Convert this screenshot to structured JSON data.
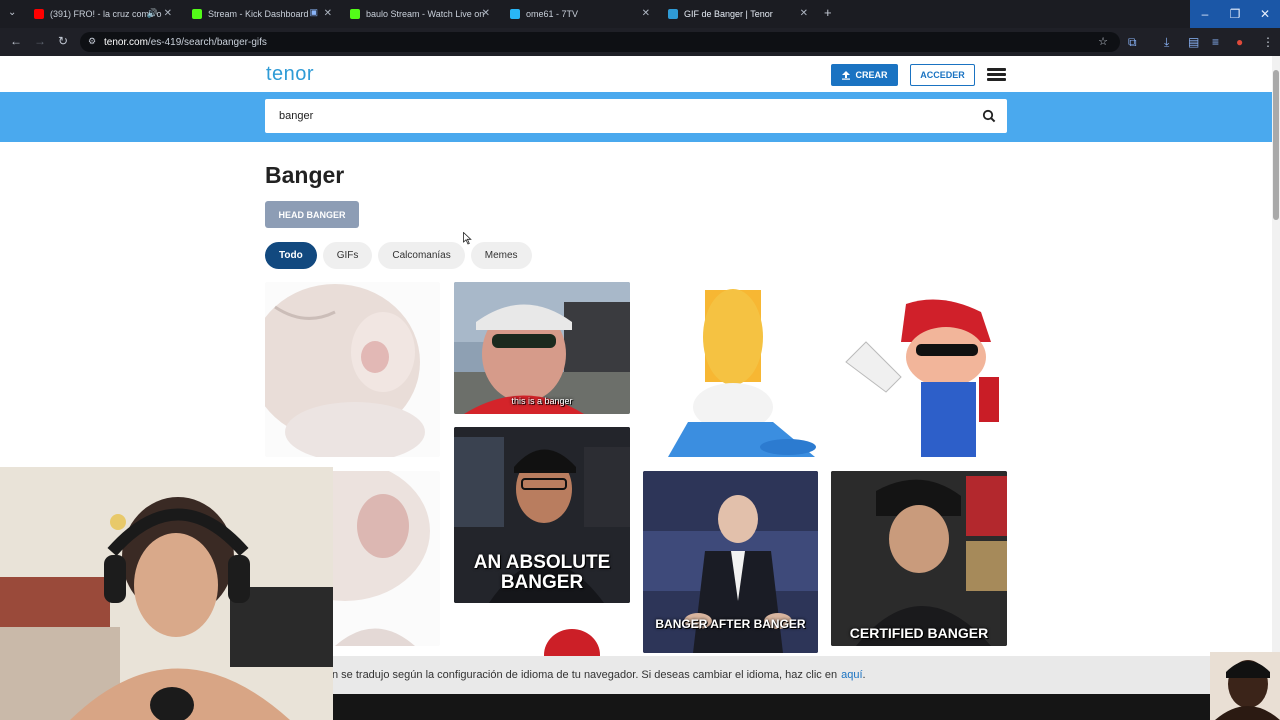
{
  "browser": {
    "tabs": [
      {
        "title": "(391) FRO! - la cruz como o",
        "fav_color": "#ff0000",
        "active": false
      },
      {
        "title": "Stream - Kick Dashboard",
        "fav_color": "#53fc18",
        "active": false
      },
      {
        "title": "baulo Stream - Watch Live on",
        "fav_color": "#53fc18",
        "active": false
      },
      {
        "title": "ome61 - 7TV",
        "fav_color": "#29b6f6",
        "active": false
      },
      {
        "title": "GIF de Banger | Tenor",
        "fav_color": "#2f9bd6",
        "active": true
      }
    ],
    "url_host": "tenor.com",
    "url_path": "/es-419/search/banger-gifs"
  },
  "header": {
    "logo": "tenor",
    "create_label": "CREAR",
    "login_label": "ACCEDER"
  },
  "search": {
    "value": "banger"
  },
  "page": {
    "title": "Banger",
    "related_label": "HEAD BANGER",
    "filters": [
      {
        "label": "Todo",
        "active": true
      },
      {
        "label": "GIFs",
        "active": false
      },
      {
        "label": "Calcomanías",
        "active": false
      },
      {
        "label": "Memes",
        "active": false
      }
    ]
  },
  "gifs": [
    {
      "caption": ""
    },
    {
      "caption": "this is a banger"
    },
    {
      "caption": ""
    },
    {
      "caption": ""
    },
    {
      "caption": ""
    },
    {
      "caption": "AN ABSOLUTE BANGER"
    },
    {
      "caption": "BANGER AFTER BANGER"
    },
    {
      "caption": "CERTIFIED BANGER"
    },
    {
      "caption": ""
    }
  ],
  "language_notice": {
    "text": "n se tradujo según la configuración de idioma de tu navegador. Si deseas cambiar el idioma, haz clic en",
    "link": "aquí",
    "end": "."
  },
  "colors": {
    "brand": "#2f9bd6",
    "search_band": "#4aa9ee",
    "primary_button": "#1a73c2",
    "active_filter": "#12497f"
  }
}
